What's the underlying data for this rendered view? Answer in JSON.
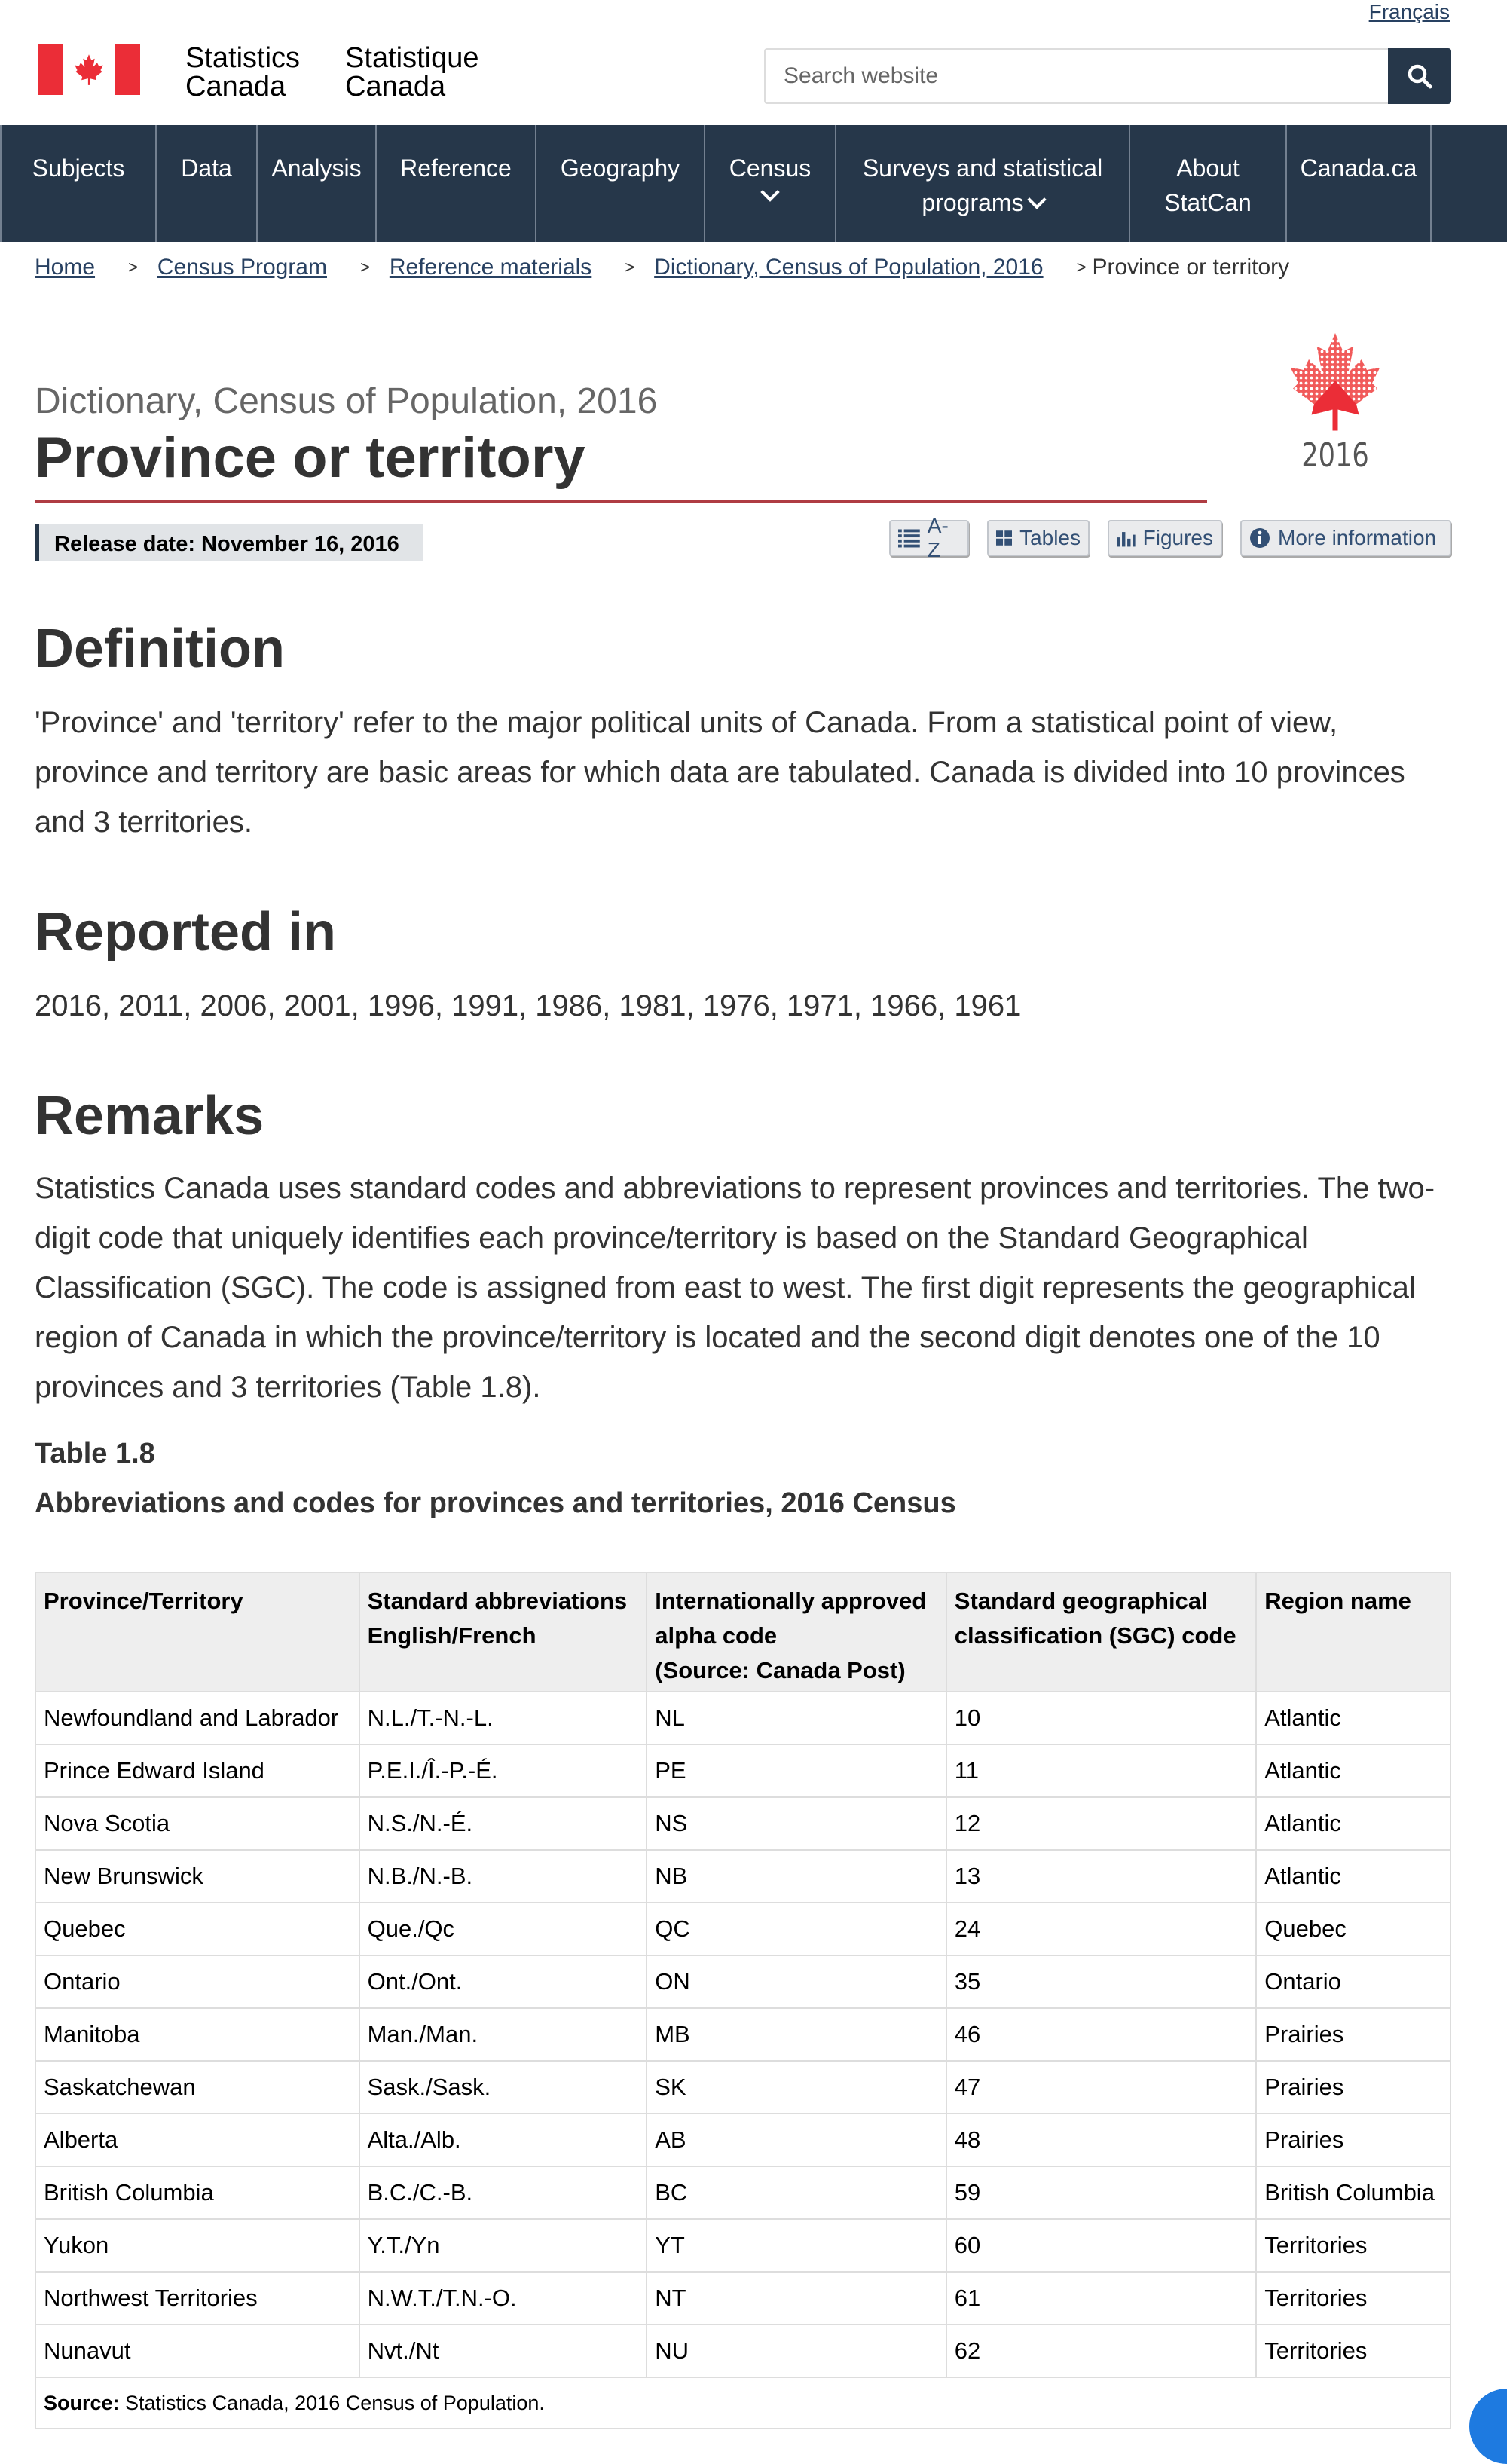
{
  "header": {
    "lang_link": "Français",
    "signature_en": [
      "Statistics",
      "Canada"
    ],
    "signature_fr": [
      "Statistique",
      "Canada"
    ],
    "search_placeholder": "Search website",
    "search_button_icon": "search-icon"
  },
  "menu": [
    {
      "label": "Subjects"
    },
    {
      "label": "Data"
    },
    {
      "label": "Analysis"
    },
    {
      "label": "Reference"
    },
    {
      "label": "Geography"
    },
    {
      "label": "Census"
    },
    {
      "label": "Surveys and statistical programs"
    },
    {
      "label": "About StatCan"
    },
    {
      "label": "Canada.ca"
    }
  ],
  "menu_lines": {
    "surveys_l1": "Surveys and statistical",
    "surveys_l2": "programs",
    "about_l1": "About",
    "about_l2": "StatCan"
  },
  "breadcrumb": {
    "items": [
      "Home",
      "Census Program",
      "Reference materials",
      "Dictionary, Census of Population, 2016"
    ],
    "current": "Province or territory",
    "separator": ">"
  },
  "page": {
    "subtitle": "Dictionary, Census of Population, 2016",
    "title": "Province or territory",
    "logo_year": "2016",
    "release": "Release date: November 16, 2016",
    "tools": {
      "az": "A-Z",
      "tables": "Tables",
      "figures": "Figures",
      "more": "More information"
    }
  },
  "definition": {
    "heading": "Definition",
    "text": "'Province' and 'territory' refer to the major political units of Canada. From a statistical point of view, province and territory are basic areas for which data are tabulated. Canada is divided into 10 provinces and 3 territories."
  },
  "reported": {
    "heading": "Reported in",
    "text": "2016, 2011, 2006, 2001, 1996, 1991, 1986, 1981, 1976, 1971, 1966, 1961"
  },
  "remarks": {
    "heading": "Remarks",
    "text": "Statistics Canada uses standard codes and abbreviations to represent provinces and territories. The two-digit code that uniquely identifies each province/territory is based on the Standard Geographical Classification (SGC). The code is assigned from east to west. The first digit represents the geographical region of Canada in which the province/territory is located and the second digit denotes one of the 10 provinces and 3 territories (Table 1.8)."
  },
  "table": {
    "number": "Table 1.8",
    "caption": "Abbreviations and codes for provinces and territories, 2016 Census",
    "headers": {
      "c1": "Province/Territory",
      "c2a": "Standard abbreviations",
      "c2b": "English/French",
      "c3a": "Internationally approved",
      "c3b": "alpha code",
      "c3c": "(Source: Canada Post)",
      "c4a": "Standard geographical",
      "c4b": "classification (SGC) code",
      "c5": "Region name"
    },
    "rows": [
      [
        "Newfoundland and Labrador",
        "N.L./T.-N.-L.",
        "NL",
        "10",
        "Atlantic"
      ],
      [
        "Prince Edward Island",
        "P.E.I./Î.-P.-É.",
        "PE",
        "11",
        "Atlantic"
      ],
      [
        "Nova Scotia",
        "N.S./N.-É.",
        "NS",
        "12",
        "Atlantic"
      ],
      [
        "New Brunswick",
        "N.B./N.-B.",
        "NB",
        "13",
        "Atlantic"
      ],
      [
        "Quebec",
        "Que./Qc",
        "QC",
        "24",
        "Quebec"
      ],
      [
        "Ontario",
        "Ont./Ont.",
        "ON",
        "35",
        "Ontario"
      ],
      [
        "Manitoba",
        "Man./Man.",
        "MB",
        "46",
        "Prairies"
      ],
      [
        "Saskatchewan",
        "Sask./Sask.",
        "SK",
        "47",
        "Prairies"
      ],
      [
        "Alberta",
        "Alta./Alb.",
        "AB",
        "48",
        "Prairies"
      ],
      [
        "British Columbia",
        "B.C./C.-B.",
        "BC",
        "59",
        "British Columbia"
      ],
      [
        "Yukon",
        "Y.T./Yn",
        "YT",
        "60",
        "Territories"
      ],
      [
        "Northwest Territories",
        "N.W.T./T.N.-O.",
        "NT",
        "61",
        "Territories"
      ],
      [
        "Nunavut",
        "Nvt./Nt",
        "NU",
        "62",
        "Territories"
      ]
    ],
    "source_label": "Source:",
    "source_text": " Statistics Canada, 2016 Census of Population."
  },
  "colors": {
    "nav": "#26374a",
    "accent_red": "#af3c43",
    "flag_red": "#eb2d37"
  }
}
